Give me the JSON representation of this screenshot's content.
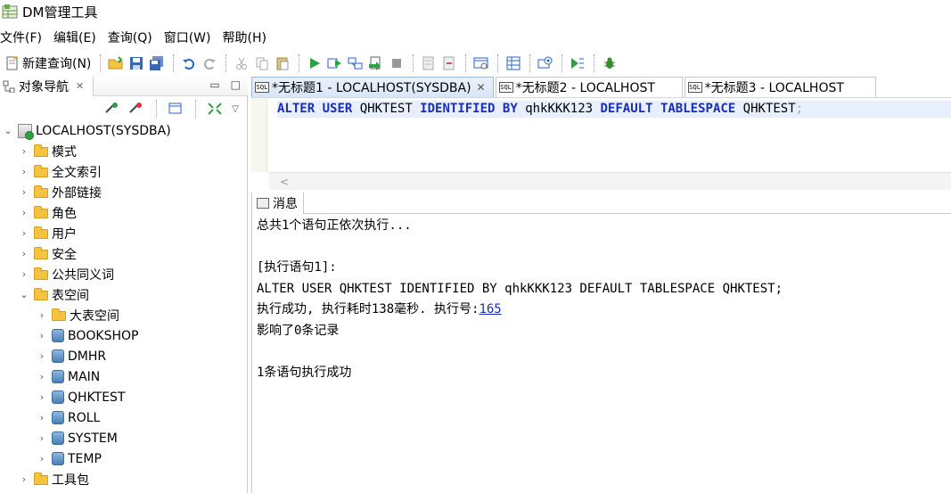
{
  "window": {
    "title": "DM管理工具"
  },
  "menu": [
    "文件(F)",
    "编辑(E)",
    "查询(Q)",
    "窗口(W)",
    "帮助(H)"
  ],
  "toolbar": {
    "new_query_label": "新建查询(N)"
  },
  "nav": {
    "tab_label": "对象导航",
    "root": "LOCALHOST(SYSDBA)",
    "items": [
      {
        "label": "模式",
        "icon": "folder-icon",
        "level": 1,
        "expanded": false
      },
      {
        "label": "全文索引",
        "icon": "folder-icon",
        "level": 1,
        "expanded": false
      },
      {
        "label": "外部链接",
        "icon": "folder-icon",
        "level": 1,
        "expanded": false
      },
      {
        "label": "角色",
        "icon": "folder-icon",
        "level": 1,
        "expanded": false
      },
      {
        "label": "用户",
        "icon": "folder-icon",
        "level": 1,
        "expanded": false
      },
      {
        "label": "安全",
        "icon": "folder-icon",
        "level": 1,
        "expanded": false
      },
      {
        "label": "公共同义词",
        "icon": "folder-icon",
        "level": 1,
        "expanded": false
      },
      {
        "label": "表空间",
        "icon": "folder-icon",
        "level": 1,
        "expanded": true
      },
      {
        "label": "大表空间",
        "icon": "folder-icon",
        "level": 2,
        "expanded": false
      },
      {
        "label": "BOOKSHOP",
        "icon": "tablespace-icon",
        "level": 2,
        "expanded": false
      },
      {
        "label": "DMHR",
        "icon": "tablespace-icon",
        "level": 2,
        "expanded": false
      },
      {
        "label": "MAIN",
        "icon": "tablespace-icon",
        "level": 2,
        "expanded": false
      },
      {
        "label": "QHKTEST",
        "icon": "tablespace-icon",
        "level": 2,
        "expanded": false
      },
      {
        "label": "ROLL",
        "icon": "tablespace-icon",
        "level": 2,
        "expanded": false
      },
      {
        "label": "SYSTEM",
        "icon": "tablespace-icon",
        "level": 2,
        "expanded": false
      },
      {
        "label": "TEMP",
        "icon": "tablespace-icon",
        "level": 2,
        "expanded": false
      },
      {
        "label": "工具包",
        "icon": "folder-icon",
        "level": 1,
        "expanded": false
      }
    ]
  },
  "editor": {
    "tabs": [
      {
        "label": "*无标题1 - LOCALHOST(SYSDBA)",
        "active": true
      },
      {
        "label": "*无标题2 - LOCALHOST",
        "active": false
      },
      {
        "label": "*无标题3 - LOCALHOST",
        "active": false
      }
    ],
    "sql_tokens": [
      {
        "t": "ALTER",
        "kw": true
      },
      {
        "t": " ",
        "kw": false
      },
      {
        "t": "USER",
        "kw": true
      },
      {
        "t": " QHKTEST ",
        "kw": false
      },
      {
        "t": "IDENTIFIED",
        "kw": true
      },
      {
        "t": " ",
        "kw": false
      },
      {
        "t": "BY",
        "kw": true
      },
      {
        "t": " qhkKKK123 ",
        "kw": false
      },
      {
        "t": "DEFAULT",
        "kw": true
      },
      {
        "t": " ",
        "kw": false
      },
      {
        "t": "TABLESPACE",
        "kw": true
      },
      {
        "t": " QHKTEST",
        "kw": false
      }
    ],
    "sql_semicolon": ";",
    "scroll_hint": "<"
  },
  "messages": {
    "tab_label": "消息",
    "line1": "总共1个语句正依次执行...",
    "line2": "",
    "line3": "[执行语句1]:",
    "line4": "ALTER USER QHKTEST IDENTIFIED BY qhkKKK123 DEFAULT TABLESPACE QHKTEST;",
    "line5_prefix": "执行成功, 执行耗时138毫秒. 执行号:",
    "line5_link": "165",
    "line6": "影响了0条记录",
    "line7": "",
    "line8": "1条语句执行成功"
  },
  "colors": {
    "keyword": "#1a2fb5",
    "folder": "#f5c242",
    "run": "#2ea043"
  }
}
